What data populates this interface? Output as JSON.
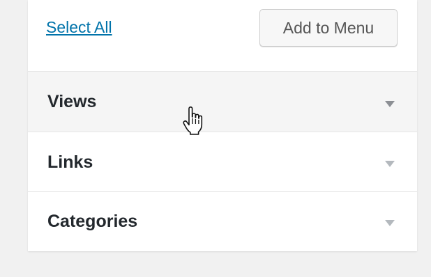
{
  "actions": {
    "select_all_label": "Select All",
    "add_to_menu_label": "Add to Menu"
  },
  "sections": [
    {
      "title": "Views",
      "icon": "chevron-down-icon",
      "hovered": true
    },
    {
      "title": "Links",
      "icon": "chevron-down-icon",
      "hovered": false
    },
    {
      "title": "Categories",
      "icon": "chevron-down-icon",
      "hovered": false
    }
  ],
  "cursor": {
    "icon": "hand-pointer-icon"
  },
  "colors": {
    "link": "#0073aa",
    "heading_text": "#23282d",
    "hover_background": "#f5f5f5",
    "button_text": "#555555"
  }
}
